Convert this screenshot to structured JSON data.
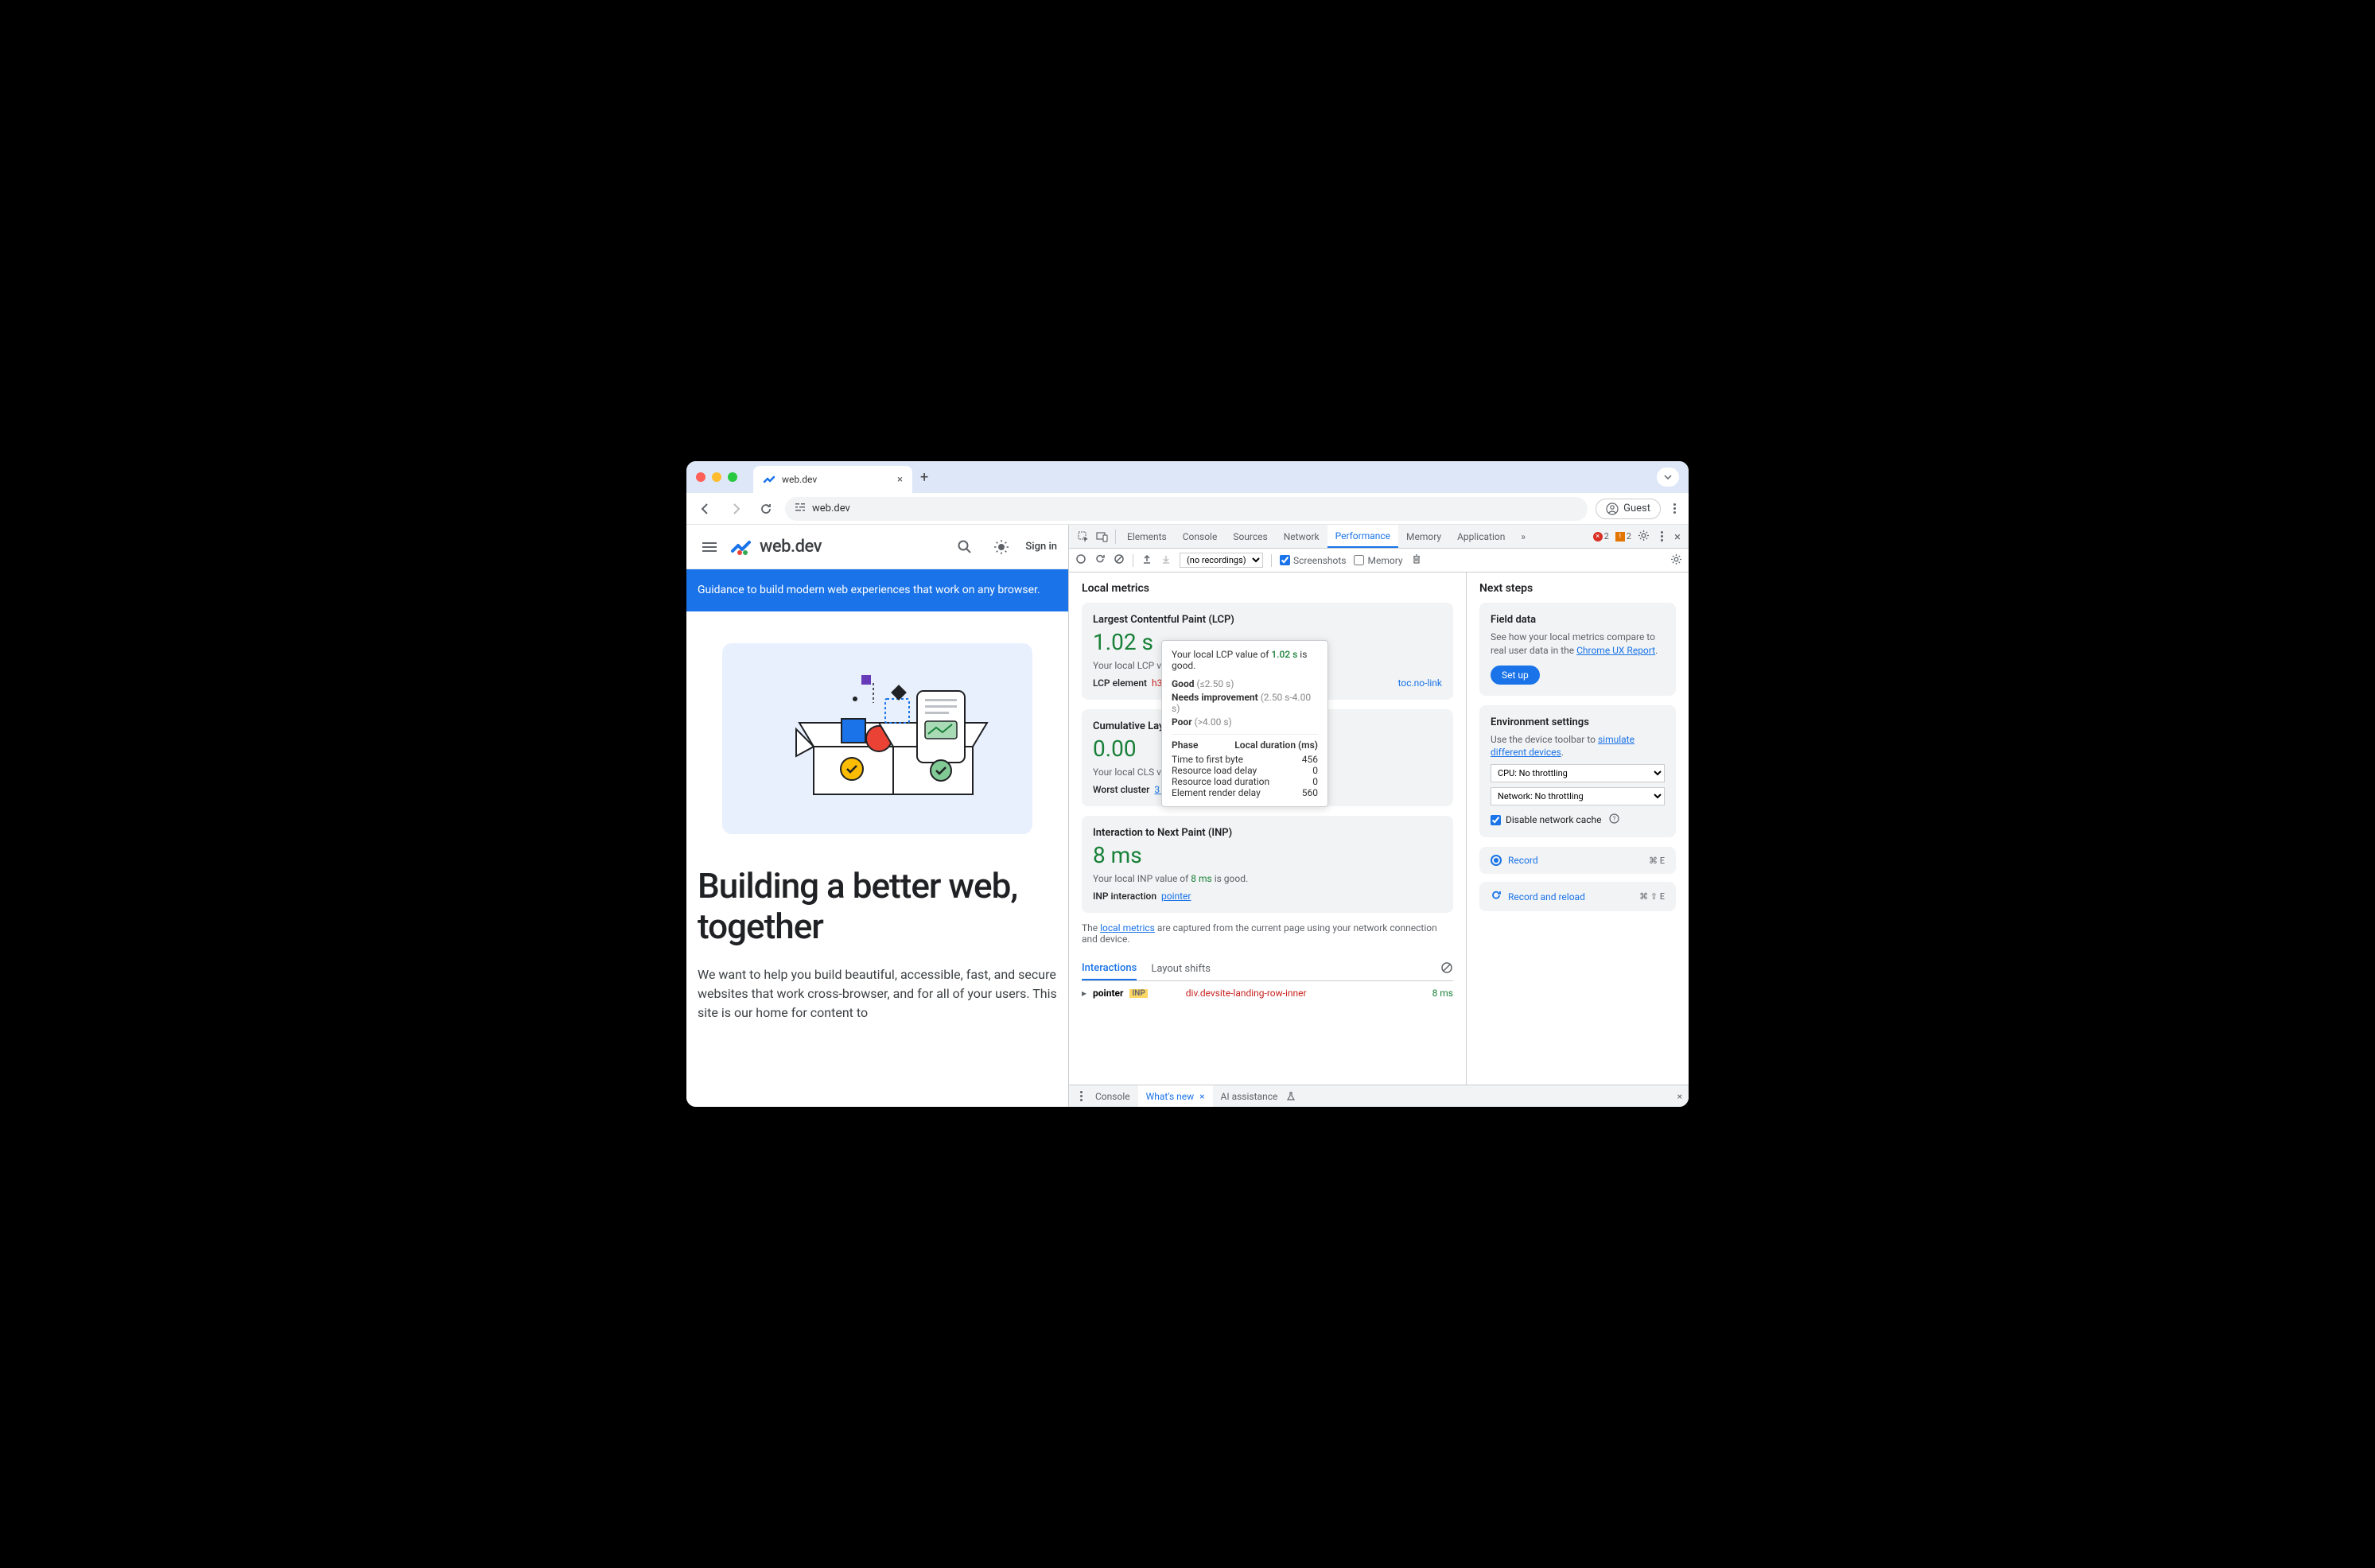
{
  "browser": {
    "tab_title": "web.dev",
    "url": "web.dev",
    "guest_label": "Guest"
  },
  "page": {
    "brand": "web.dev",
    "signin": "Sign in",
    "banner": "Guidance to build modern web experiences that work on any browser.",
    "hero_title": "Building a better web, together",
    "hero_body": "We want to help you build beautiful, accessible, fast, and secure websites that work cross-browser, and for all of your users. This site is our home for content to"
  },
  "devtools": {
    "tabs": [
      "Elements",
      "Console",
      "Sources",
      "Network",
      "Performance",
      "Memory",
      "Application"
    ],
    "active_tab": "Performance",
    "errors": "2",
    "warnings": "2",
    "recordings_placeholder": "(no recordings)",
    "screenshots_label": "Screenshots",
    "memory_label": "Memory",
    "local_metrics_title": "Local metrics",
    "lcp": {
      "title": "Largest Contentful Paint (LCP)",
      "value": "1.02 s",
      "desc_prefix": "Your local LCP valu",
      "sub_label": "LCP element",
      "sub_elem": "h3#b",
      "sub_class": "toc.no-link"
    },
    "tooltip": {
      "line1_prefix": "Your local LCP value of ",
      "line1_val": "1.02 s",
      "line1_suffix": " is good.",
      "good": "Good",
      "good_range": "(≤2.50 s)",
      "ni": "Needs improvement",
      "ni_range": "(2.50 s-4.00 s)",
      "poor": "Poor",
      "poor_range": "(>4.00 s)",
      "phase_h1": "Phase",
      "phase_h2": "Local duration (ms)",
      "ttfb_l": "Time to first byte",
      "ttfb_v": "456",
      "rld_l": "Resource load delay",
      "rld_v": "0",
      "rldur_l": "Resource load duration",
      "rldur_v": "0",
      "erd_l": "Element render delay",
      "erd_v": "560"
    },
    "cls": {
      "title": "Cumulative Layo",
      "value": "0.00",
      "desc_prefix": "Your local CLS valu",
      "sub_label": "Worst cluster",
      "sub_link": "3 shifts"
    },
    "inp": {
      "title": "Interaction to Next Paint (INP)",
      "value": "8 ms",
      "desc_prefix": "Your local INP value of ",
      "desc_val": "8 ms",
      "desc_suffix": " is good.",
      "sub_label": "INP interaction",
      "sub_link": "pointer"
    },
    "footer_prefix": "The ",
    "footer_link": "local metrics",
    "footer_suffix": " are captured from the current page using your network connection and device.",
    "itabs": {
      "interactions": "Interactions",
      "layout_shifts": "Layout shifts"
    },
    "interaction_row": {
      "kind": "pointer",
      "badge": "INP",
      "target": "div.devsite-landing-row-inner",
      "timing": "8 ms"
    },
    "side": {
      "next_steps": "Next steps",
      "field_title": "Field data",
      "field_body_prefix": "See how your local metrics compare to real user data in the ",
      "field_link": "Chrome UX Report",
      "setup": "Set up",
      "env_title": "Environment settings",
      "env_body_prefix": "Use the device toolbar to ",
      "env_link": "simulate different devices",
      "cpu_option": "CPU: No throttling",
      "net_option": "Network: No throttling",
      "disable_cache": "Disable network cache",
      "record": "Record",
      "record_kbd": "⌘ E",
      "record_reload": "Record and reload",
      "record_reload_kbd": "⌘ ⇧ E"
    },
    "drawer": {
      "console": "Console",
      "whatsnew": "What's new",
      "ai": "AI assistance"
    }
  }
}
